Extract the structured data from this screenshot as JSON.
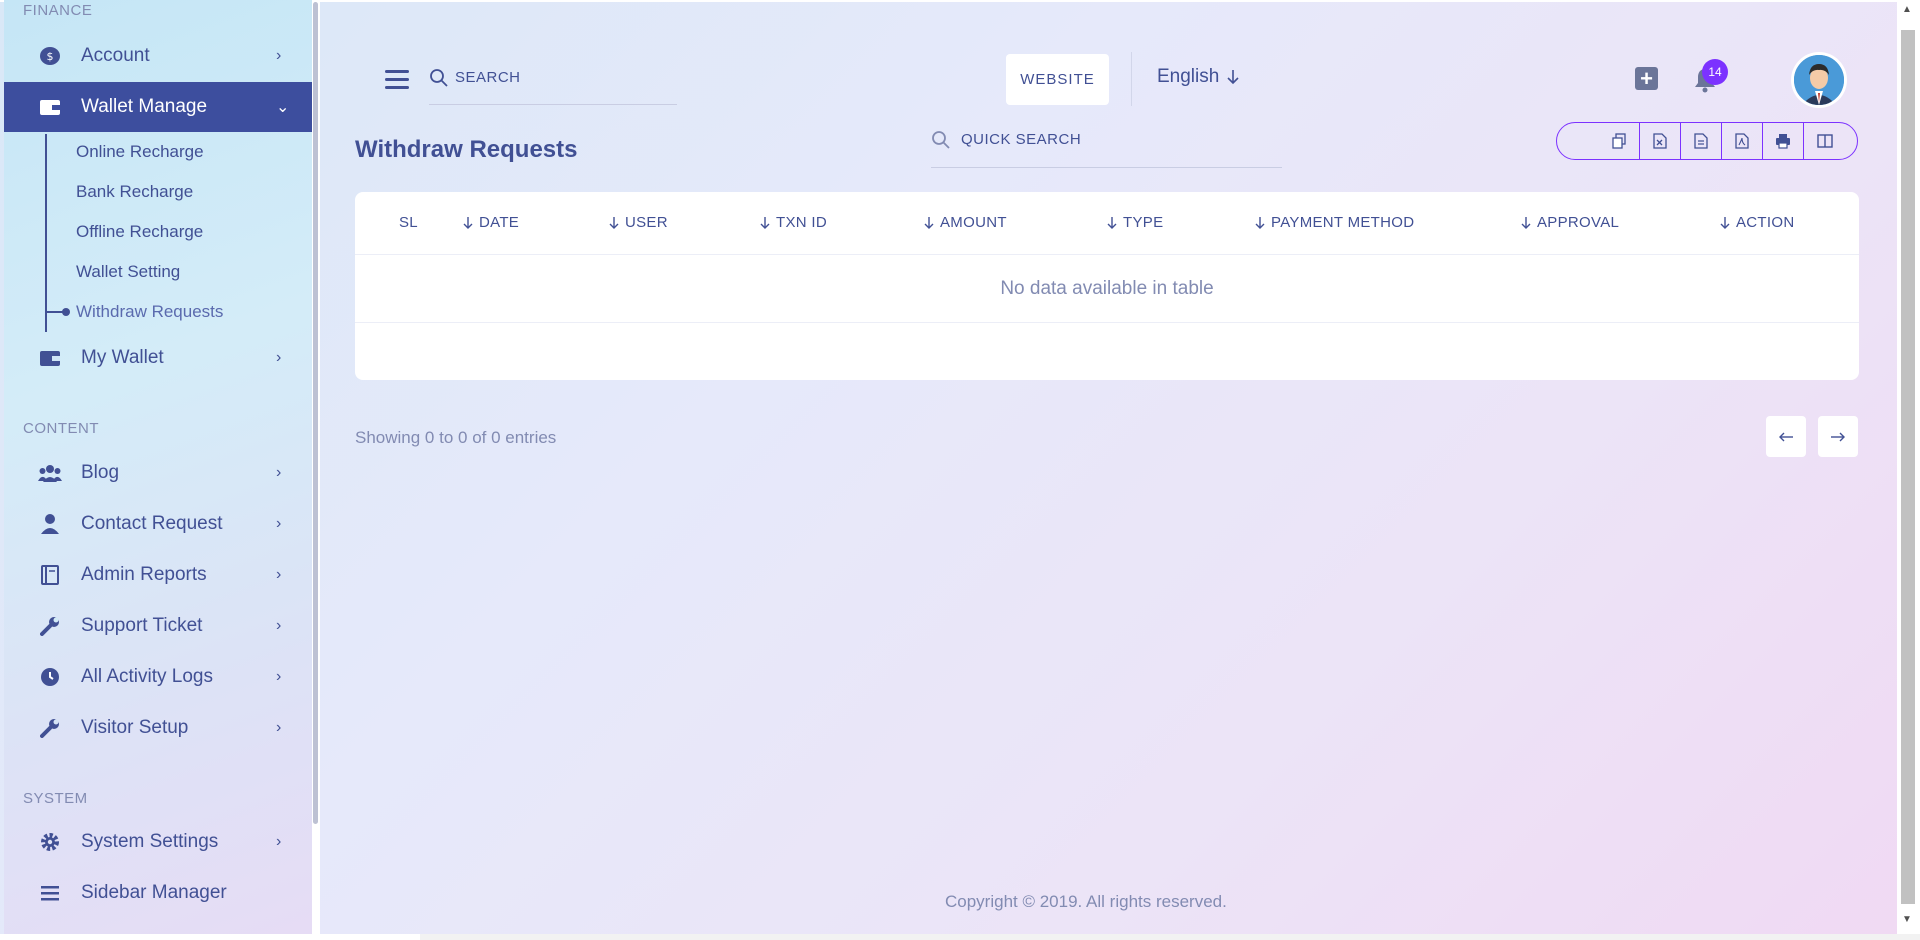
{
  "sidebar": {
    "section_finance": "FINANCE",
    "section_content": "CONTENT",
    "section_system": "SYSTEM",
    "items": [
      {
        "label": "Account",
        "icon": "dollar-icon"
      },
      {
        "label": "Wallet Manage",
        "icon": "wallet-icon"
      },
      {
        "label": "My Wallet",
        "icon": "wallet-icon"
      },
      {
        "label": "Blog",
        "icon": "users-icon"
      },
      {
        "label": "Contact Request",
        "icon": "user-icon"
      },
      {
        "label": "Admin Reports",
        "icon": "report-icon"
      },
      {
        "label": "Support Ticket",
        "icon": "wrench-icon"
      },
      {
        "label": "All Activity Logs",
        "icon": "clock-icon"
      },
      {
        "label": "Visitor Setup",
        "icon": "wrench-icon"
      },
      {
        "label": "System Settings",
        "icon": "gear-icon"
      },
      {
        "label": "Sidebar Manager",
        "icon": "list-icon"
      }
    ],
    "sub_items": [
      "Online Recharge",
      "Bank Recharge",
      "Offline Recharge",
      "Wallet Setting",
      "Withdraw Requests"
    ]
  },
  "header": {
    "search_placeholder": "SEARCH",
    "website_label": "WEBSITE",
    "language": "English",
    "notification_count": "14"
  },
  "main": {
    "title": "Withdraw Requests",
    "quick_search_placeholder": "QUICK SEARCH",
    "columns": [
      "SL",
      "DATE",
      "USER",
      "TXN ID",
      "AMOUNT",
      "TYPE",
      "PAYMENT METHOD",
      "APPROVAL",
      "ACTION"
    ],
    "empty_message": "No data available in table",
    "showing": "Showing 0 to 0 of 0 entries"
  },
  "footer": {
    "copyright": "Copyright © 2019. All rights reserved."
  },
  "colors": {
    "accent": "#7c32ff",
    "primary": "#415094",
    "active_bg": "#3d4e9e"
  }
}
